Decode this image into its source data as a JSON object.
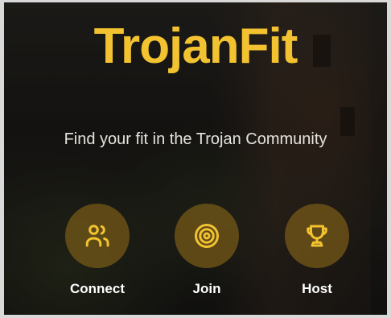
{
  "app": {
    "title": "TrojanFit",
    "tagline": "Find your fit in the Trojan Community"
  },
  "actions": [
    {
      "label": "Connect",
      "icon": "users-icon"
    },
    {
      "label": "Join",
      "icon": "target-icon"
    },
    {
      "label": "Host",
      "icon": "trophy-icon"
    }
  ],
  "colors": {
    "accent": "#f2c230",
    "icon_circle": "#785c18",
    "label_text": "#ffffff",
    "tagline_text": "#e6e4de"
  }
}
